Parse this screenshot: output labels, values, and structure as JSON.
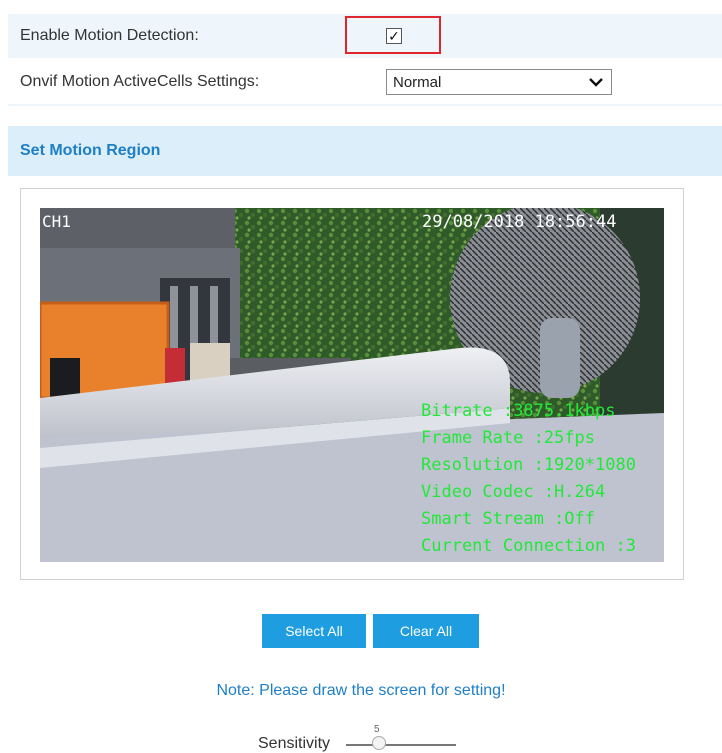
{
  "settings": {
    "motion_detection": {
      "label": "Enable Motion Detection:",
      "checked": true,
      "check_glyph": "✓"
    },
    "onvif": {
      "label": "Onvif Motion ActiveCells Settings:",
      "selected": "Normal"
    }
  },
  "region": {
    "title": "Set Motion Region"
  },
  "video": {
    "channel": "CH1",
    "timestamp": "29/08/2018 18:56:44",
    "osd_lines": [
      "Bitrate :3875.1kbps",
      "Frame Rate :25fps",
      "Resolution :1920*1080",
      "Video Codec :H.264",
      "Smart Stream :Off",
      "Current Connection :3"
    ]
  },
  "buttons": {
    "select_all": "Select All",
    "clear_all": "Clear All"
  },
  "note": "Note: Please draw the screen for setting!",
  "sensitivity": {
    "label": "Sensitivity",
    "value": "5"
  },
  "colors": {
    "accent": "#1e9ee0",
    "section_bg": "#dbeefa",
    "row_alt_bg": "#eef6fc",
    "highlight_red": "#e0252d",
    "osd_green": "#22e83a"
  }
}
